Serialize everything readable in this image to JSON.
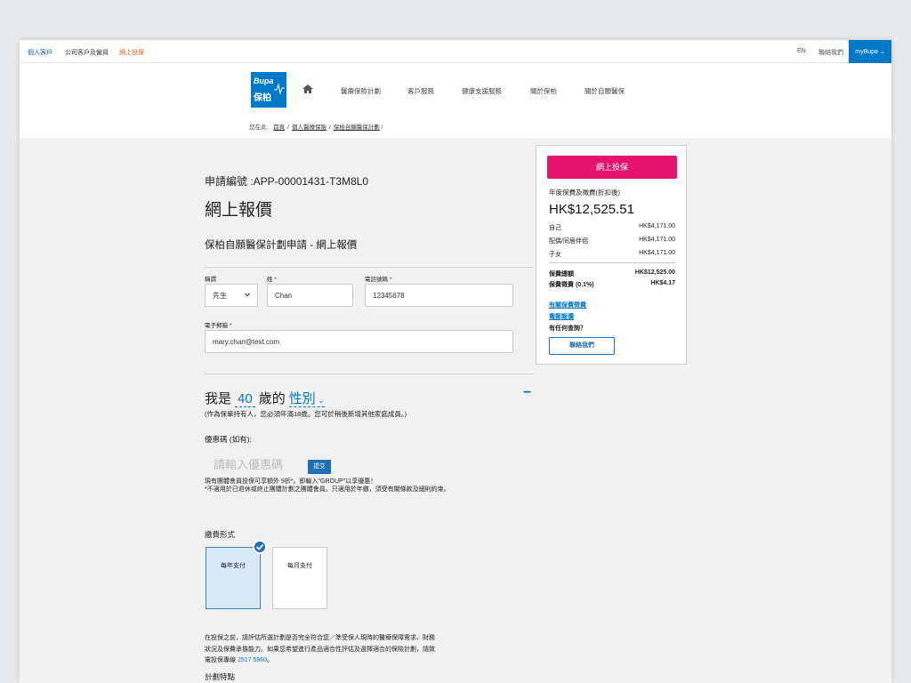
{
  "utilbar": {
    "tabs": [
      "個人客戶",
      "公司客戶及僱員",
      "網上投保"
    ],
    "lang": "EN",
    "contact": "聯絡我們",
    "mybupa": "myBupa"
  },
  "header": {
    "logo_en": "Bupa",
    "logo_zh": "保柏",
    "nav": [
      "醫療保險計劃",
      "客戶服務",
      "健康支援服務",
      "關於保柏",
      "關於自願醫保"
    ],
    "breadcrumb": {
      "prefix": "您在此:",
      "items": [
        "首頁",
        "個人醫療保險",
        "保柏自願醫保計劃"
      ],
      "suffix": "/"
    }
  },
  "form": {
    "app_no": "申請編號 :APP-00001431-T3M8L0",
    "title": "網上報價",
    "subtitle": "保柏自願醫保計劃申請 - 網上報價",
    "salutation": {
      "label": "稱謂",
      "value": "先生"
    },
    "surname": {
      "label": "姓",
      "value": "Chan"
    },
    "phone": {
      "label": "電話號碼",
      "value": "12345678"
    },
    "email": {
      "label": "電子郵箱",
      "value": "mary.chan@test.com"
    },
    "required_mark": "*",
    "iam": {
      "prefix": "我是",
      "age": "40",
      "mid": "歲的",
      "gender": "性別"
    },
    "collapse_symbol": "−",
    "iam_note": "(作為保單持有人，您必須年滿18歲。您可於稍後新增其他家庭成員。)",
    "promo": {
      "label": "優惠碼 (如有):",
      "placeholder": "請輸入優惠碼",
      "submit": "提交",
      "note1": "現有團體會員投保可享額外 9折*。即輸入\"GROUP\"以享優惠！",
      "note2": "*不適用於已退休或終止團體計劃之團體會員。只適用於年繳，須受有關條款及細則約束。"
    },
    "payment": {
      "label": "繳費形式",
      "annual": "每年支付",
      "monthly": "每月支付"
    },
    "disclaimer_lines": [
      "在投保之前，請評估所選計劃是否完全符合您／準受保人現時的醫療保障需求、財務",
      "狀況及保費承擔能力。如果您希望進行產品適合性評估及選擇適合的保險計劃，請致"
    ],
    "disclaimer_last": "電投保專線",
    "disclaimer_phone": "2517 5860",
    "disclaimer_end": "。",
    "features": "計劃特點"
  },
  "summary": {
    "apply": "網上投保",
    "label": "年度保費及徵費(折扣後)",
    "total": "HK$12,525.51",
    "rows": [
      {
        "label": "自己",
        "value": "HK$4,171.00"
      },
      {
        "label": "配偶/同居伴侶",
        "value": "HK$4,171.00"
      },
      {
        "label": "子女",
        "value": "HK$4,171.00"
      }
    ],
    "premium": {
      "label": "保費總額",
      "value": "HK$12,525.00"
    },
    "levy": {
      "label": "保費徵費 (0.1%)",
      "value": "HK$4.17"
    },
    "links": [
      "有關保費徵費",
      "電郵報價"
    ],
    "question": "有任何查詢？",
    "contact_btn": "聯絡我們"
  },
  "colors": {
    "brand_blue": "#0079c8",
    "apply_pink": "#e6136f",
    "orange": "#e05a1e"
  }
}
